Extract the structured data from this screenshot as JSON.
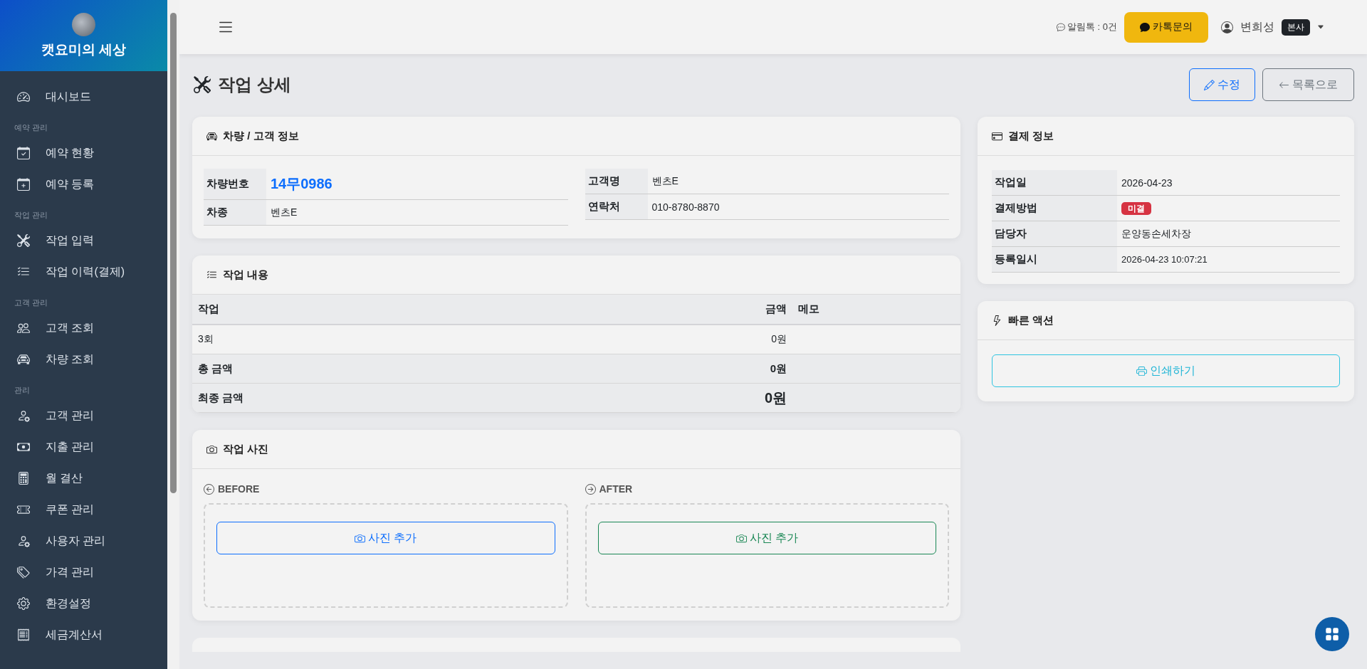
{
  "sidebar": {
    "brand": "캣요미의 세상",
    "groups": [
      {
        "items": [
          {
            "label": "대시보드",
            "selected": false
          }
        ]
      },
      {
        "label": "예약 관리",
        "items": [
          {
            "label": "예약 현황",
            "selected": false
          },
          {
            "label": "예약 등록",
            "selected": false
          }
        ]
      },
      {
        "label": "작업 관리",
        "items": [
          {
            "label": "작업 입력",
            "selected": false
          },
          {
            "label": "작업 이력(결제)",
            "selected": false
          }
        ]
      },
      {
        "label": "고객 관리",
        "items": [
          {
            "label": "고객 조회",
            "selected": false
          },
          {
            "label": "차량 조회",
            "selected": false
          }
        ]
      },
      {
        "label": "관리",
        "items": [
          {
            "label": "고객 관리",
            "selected": false
          },
          {
            "label": "지출 관리",
            "selected": false
          },
          {
            "label": "월 결산",
            "selected": false
          },
          {
            "label": "쿠폰 관리",
            "selected": false
          },
          {
            "label": "사용자 관리",
            "selected": false
          },
          {
            "label": "가격 관리",
            "selected": false
          },
          {
            "label": "환경설정",
            "selected": false
          },
          {
            "label": "세금계산서",
            "selected": false
          }
        ]
      }
    ]
  },
  "header": {
    "alimtalk": "알림톡 : 0건",
    "kakao_button": "카톡문의",
    "user": "변희성",
    "branch": "본사"
  },
  "page": {
    "title": "작업 상세",
    "buttons": [
      {
        "label": "수정",
        "kind": "edit"
      },
      {
        "label": "목록으로",
        "kind": "back"
      }
    ]
  },
  "vehicle_card": {
    "title": "차량 / 고객 정보",
    "left": [
      {
        "label": "차량번호",
        "value": "14무0986",
        "kind": "plate"
      },
      {
        "label": "차종",
        "value": "벤츠E"
      }
    ],
    "right": [
      {
        "label": "고객명",
        "value": "벤츠E"
      },
      {
        "label": "연락처",
        "value": "010-8780-8870"
      }
    ]
  },
  "work_card": {
    "title": "작업 내용",
    "columns": [
      "작업",
      "금액",
      "메모"
    ],
    "rows": [
      {
        "work": "3회",
        "amount": "0원",
        "kind": "item"
      },
      {
        "work": "총 금액",
        "amount": "0원",
        "kind": "total"
      },
      {
        "work": "최종 금액",
        "amount": "0원",
        "kind": "final"
      }
    ]
  },
  "photo_card": {
    "title": "작업 사진",
    "slots": [
      {
        "label": "BEFORE",
        "button": "사진 추가",
        "kind": "before"
      },
      {
        "label": "AFTER",
        "button": "사진 추가",
        "kind": "after"
      }
    ]
  },
  "payment_card": {
    "title": "결제 정보",
    "rows": [
      {
        "label": "작업일",
        "value": "2026-04-23"
      },
      {
        "label": "결제방법",
        "value": "미결",
        "kind": "badge"
      },
      {
        "label": "담당자",
        "value": "운양동손세차장"
      },
      {
        "label": "등록일시",
        "value": "2026-04-23 10:07:21",
        "kind": "small"
      }
    ]
  },
  "quick_card": {
    "title": "빠른 액션",
    "button": "인쇄하기"
  }
}
